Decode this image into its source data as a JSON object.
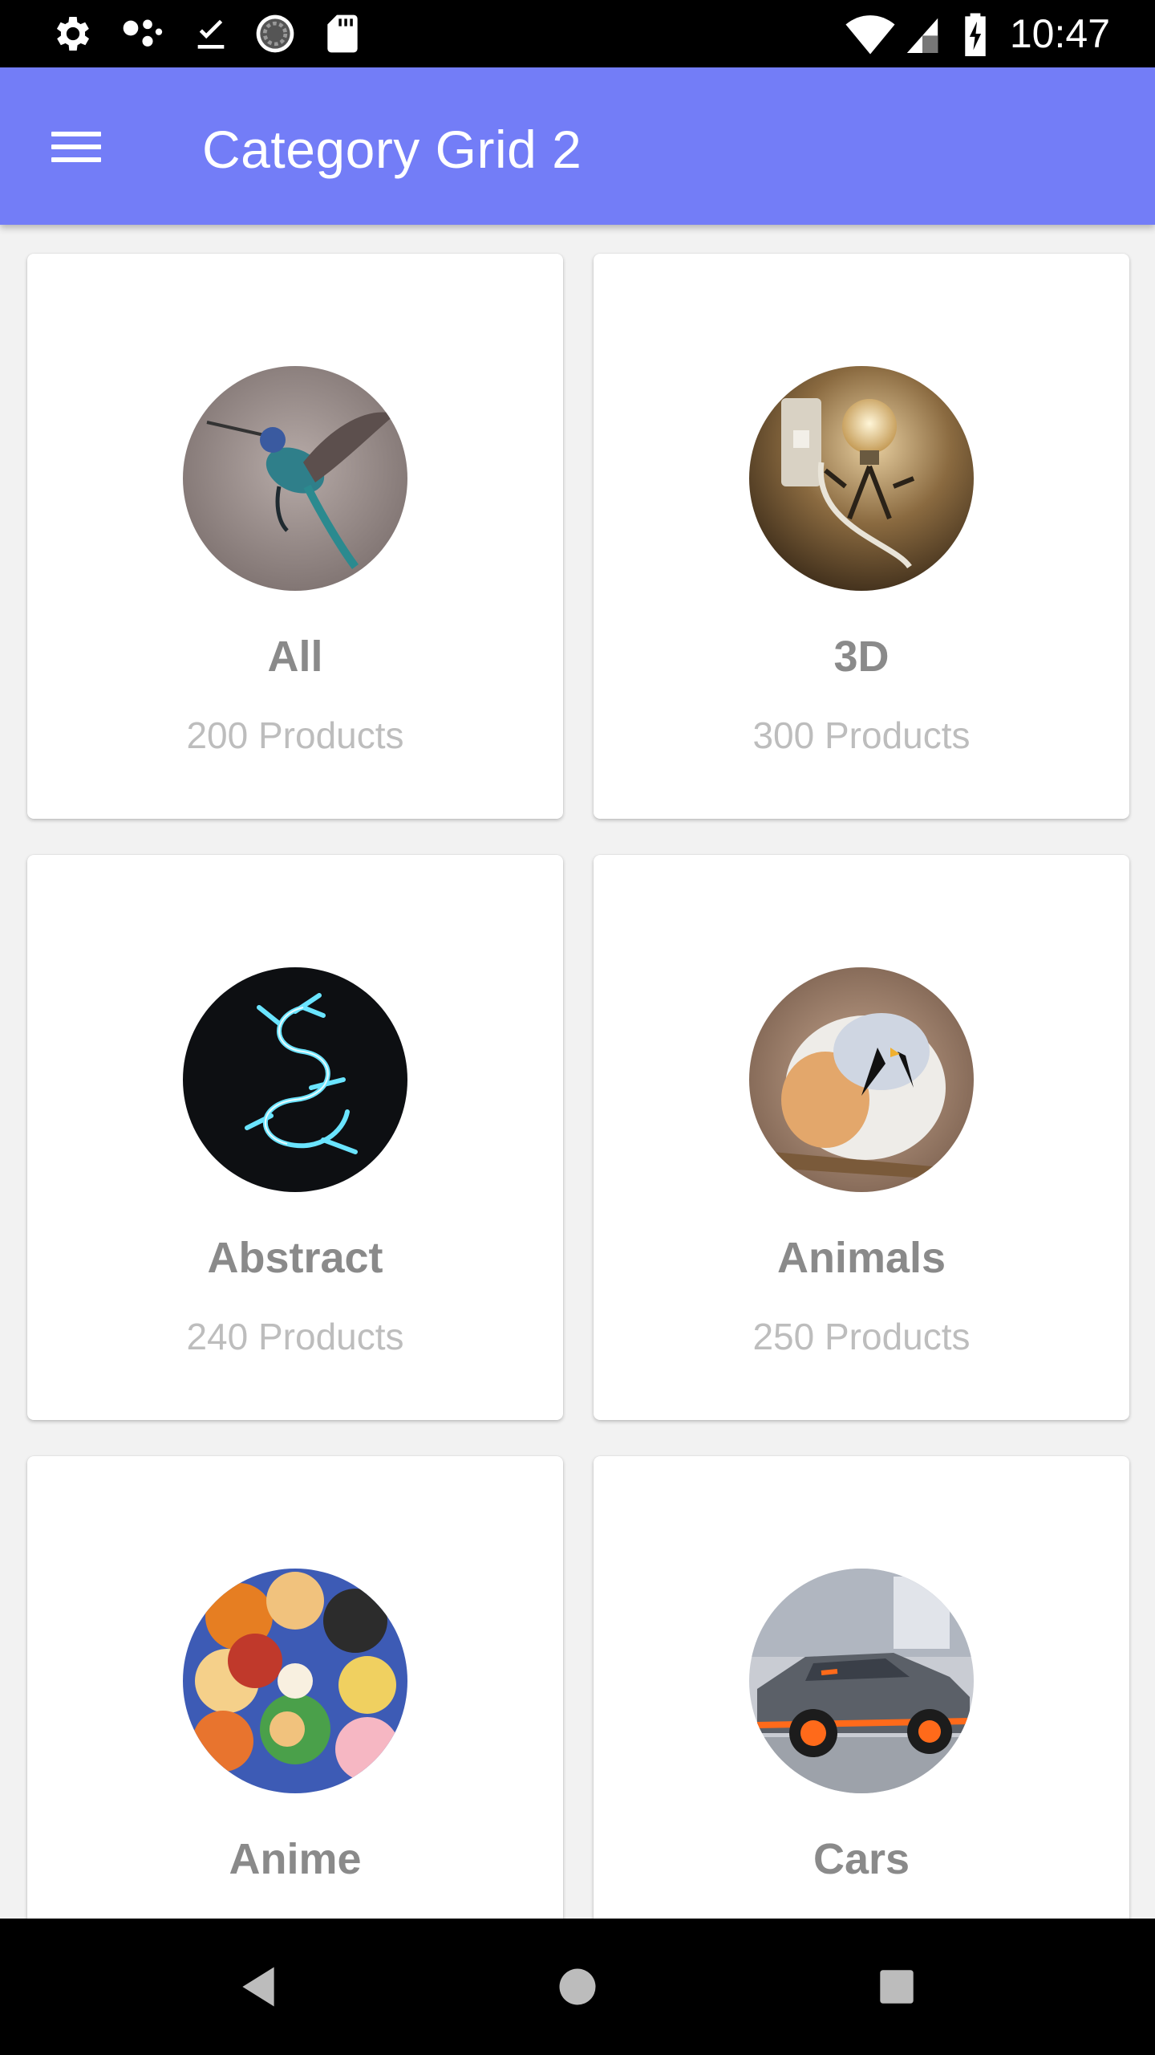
{
  "status_bar": {
    "time": "10:47",
    "left_icons": [
      "settings-icon",
      "assistant-dots-icon",
      "download-done-icon",
      "sync-circle-icon",
      "sd-card-icon"
    ],
    "right_icons": [
      "wifi-icon",
      "signal-icon",
      "battery-charging-icon"
    ]
  },
  "app_bar": {
    "title": "Category Grid 2",
    "background": "#737df7",
    "menu_icon": "hamburger-menu-icon"
  },
  "categories": [
    {
      "name": "All",
      "count": "200 Products",
      "image": "hummingbird"
    },
    {
      "name": "3D",
      "count": "300 Products",
      "image": "lightbulb-robot"
    },
    {
      "name": "Abstract",
      "count": "240 Products",
      "image": "glowing-dragon"
    },
    {
      "name": "Animals",
      "count": "250 Products",
      "image": "small-bird"
    },
    {
      "name": "Anime",
      "count": "",
      "image": "anime-collage"
    },
    {
      "name": "Cars",
      "count": "",
      "image": "sports-car"
    }
  ],
  "nav_bar": {
    "buttons": [
      "back-icon",
      "home-icon",
      "recents-icon"
    ]
  },
  "colors": {
    "accent": "#737df7",
    "title_text": "#8a8a8a",
    "subtitle_text": "#bdbdbd",
    "background": "#f2f2f2"
  }
}
